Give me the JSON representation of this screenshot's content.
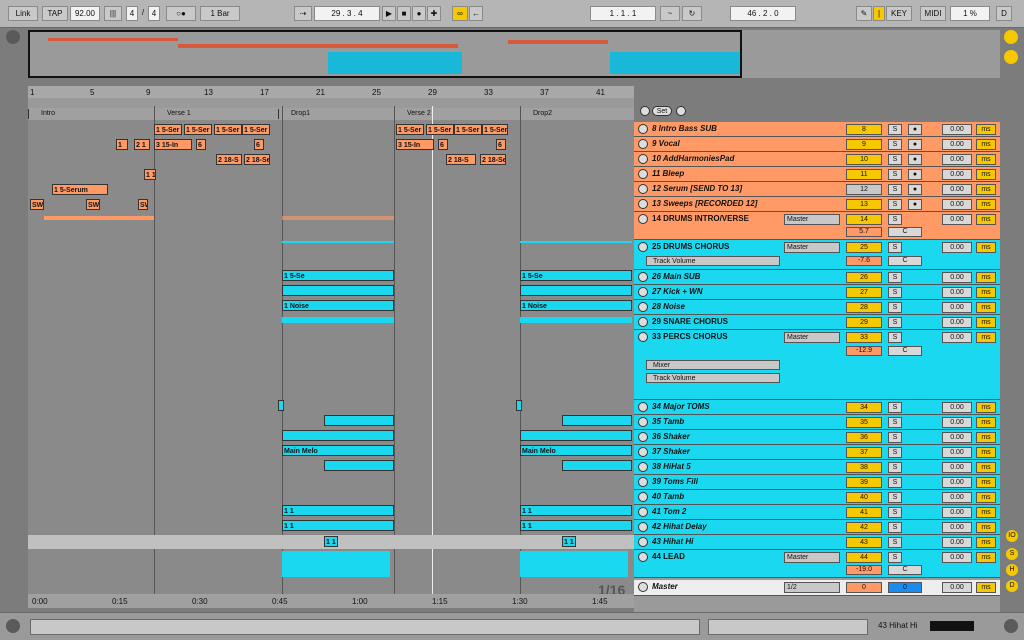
{
  "toolbar": {
    "link": "Link",
    "tap": "TAP",
    "tempo": "92.00",
    "signature_num": "4",
    "signature_den": "4",
    "metro": "○●",
    "quantize": "1 Bar",
    "position": "29 .  3 .  4",
    "loop_start": "1 .  1 .  1",
    "loop_length": "46 .  2 .  0",
    "key": "KEY",
    "midi": "MIDI",
    "cpu": "1 %",
    "d": "D"
  },
  "locators": [
    {
      "label": "Intro",
      "bar": 1
    },
    {
      "label": "Verse 1",
      "bar": 9
    },
    {
      "label": "Drop1",
      "bar": 17
    },
    {
      "label": "Verse 2",
      "bar": 25
    },
    {
      "label": "Drop2",
      "bar": 33
    }
  ],
  "bars": [
    "1",
    "5",
    "9",
    "13",
    "17",
    "21",
    "25",
    "29",
    "33",
    "37",
    "41"
  ],
  "time_ticks": [
    "0:00",
    "0:15",
    "0:30",
    "0:45",
    "1:00",
    "1:15",
    "1:30",
    "1:45"
  ],
  "zoom_ratio": "1/16",
  "set_label": "Set",
  "tracks": [
    {
      "num": "8",
      "name": "8 Intro Bass SUB",
      "color": "#ff9a66",
      "val": "0.00",
      "rec": "●"
    },
    {
      "num": "9",
      "name": "9 Vocal",
      "color": "#ff9a66",
      "val": "0.00",
      "rec": "●"
    },
    {
      "num": "10",
      "name": "10 AddHarmoniesPad",
      "color": "#ff9a66",
      "val": "0.00",
      "rec": "●"
    },
    {
      "num": "11",
      "name": "11 Bleep",
      "color": "#ff9a66",
      "val": "0.00",
      "rec": "●"
    },
    {
      "num": "12",
      "name": "12 Serum [SEND TO 13]",
      "color": "#ff9a66",
      "val": "0.00",
      "rec": "●"
    },
    {
      "num": "13",
      "name": "13 Sweeps [RECORDED 12]",
      "color": "#ff9a66",
      "val": "0.00",
      "rec": "●"
    }
  ],
  "group_drums_intro": {
    "num": "14",
    "name": "14 DRUMS INTRO/VERSE",
    "io": "Master",
    "val": "0.00",
    "vol": "5.7",
    "pan": "C"
  },
  "group_drums_chorus": {
    "num": "25",
    "name": "25 DRUMS CHORUS",
    "io": "Master",
    "val": "0.00",
    "vol": "-7.6",
    "pan": "C",
    "device": "Track Volume"
  },
  "drums_chorus_tracks": [
    {
      "num": "26",
      "name": "26 Main SUB",
      "val": "0.00"
    },
    {
      "num": "27",
      "name": "27 Kick + WN",
      "val": "0.00"
    },
    {
      "num": "28",
      "name": "28 Noise",
      "val": "0.00"
    }
  ],
  "snare": {
    "num": "29",
    "name": "29 SNARE CHORUS",
    "val": "0.00"
  },
  "percs": {
    "num": "33",
    "name": "33 PERCS CHORUS",
    "io": "Master",
    "val": "0.00",
    "vol": "-12.9",
    "pan": "C",
    "device1": "Mixer",
    "device2": "Track Volume"
  },
  "perc_tracks": [
    {
      "num": "34",
      "name": "34 Major TOMS",
      "val": "0.00"
    },
    {
      "num": "35",
      "name": "35 Tamb",
      "val": "0.00"
    },
    {
      "num": "36",
      "name": "36 Shaker",
      "val": "0.00"
    },
    {
      "num": "37",
      "name": "37 Shaker",
      "val": "0.00"
    },
    {
      "num": "38",
      "name": "38 HiHat 5",
      "val": "0.00"
    },
    {
      "num": "39",
      "name": "39 Toms Fill",
      "val": "0.00"
    },
    {
      "num": "40",
      "name": "40 Tamb",
      "val": "0.00"
    },
    {
      "num": "41",
      "name": "41 Tom 2",
      "val": "0.00"
    },
    {
      "num": "42",
      "name": "42 Hihat Delay",
      "val": "0.00"
    },
    {
      "num": "43",
      "name": "43 Hihat Hi",
      "val": "0.00"
    }
  ],
  "lead": {
    "num": "44",
    "name": "44 LEAD",
    "io": "Master",
    "val": "0.00",
    "vol": "-19.0",
    "pan": "C"
  },
  "master": {
    "name": "Master",
    "io": "1/2",
    "vol": "0",
    "pan": "0",
    "val": "0.00"
  },
  "buttons": {
    "s": "S",
    "ms": "ms"
  },
  "status": {
    "track_name": "43 Hihat Hi"
  },
  "clip_labels": {
    "serum": "1 5-Serum",
    "serum_short": "1 5-Ser",
    "in": "3 15-In",
    "n6": "6",
    "n1": "1",
    "n21": "2 1",
    "s218": "2 18-S",
    "s218b": "2 18-Se",
    "sw": "SW",
    "n11": "1 1",
    "n15": "1 5",
    "n15s": "1 5-Se",
    "noise": "1 Noise",
    "n1a": "1",
    "mainmel": "Main Melo",
    "ma": "Ma",
    "n11b": "1 1"
  }
}
